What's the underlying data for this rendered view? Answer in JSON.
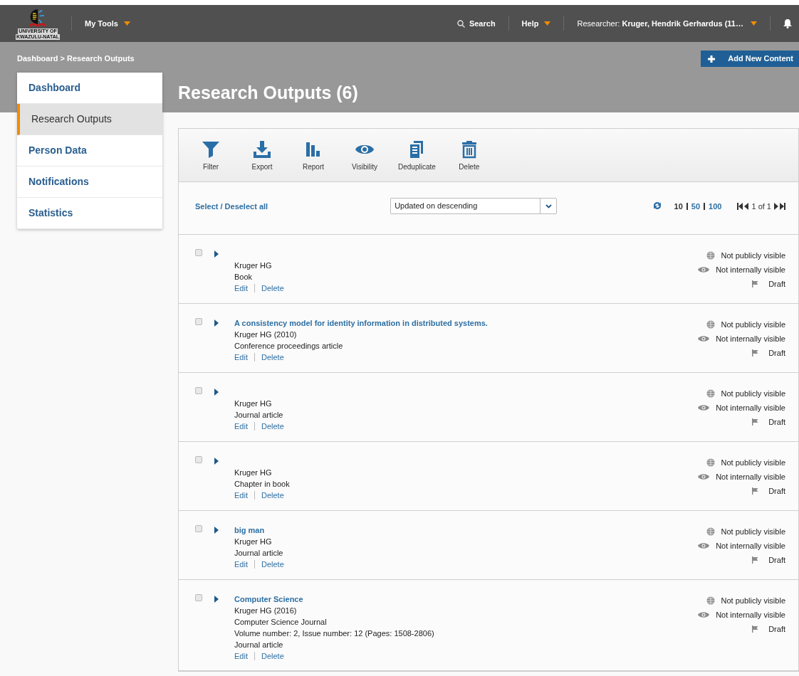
{
  "header": {
    "logo_lines": [
      "UNIVERSITY OF",
      "KWAZULU-NATAL"
    ],
    "menu": "My Tools",
    "search": "Search",
    "help": "Help",
    "user_label": "Researcher:",
    "user_name": "Kruger, Hendrik Gerhardus (11…"
  },
  "breadcrumb": "Dashboard > Research Outputs",
  "add_button": "Add New Content",
  "page_title": "Research Outputs (6)",
  "sidebar": [
    {
      "label": "Dashboard",
      "selected": false
    },
    {
      "label": "Research Outputs",
      "selected": true
    },
    {
      "label": "Person Data",
      "selected": false
    },
    {
      "label": "Notifications",
      "selected": false
    },
    {
      "label": "Statistics",
      "selected": false
    }
  ],
  "toolbar": [
    {
      "kind": "filter",
      "label": "Filter"
    },
    {
      "kind": "export",
      "label": "Export"
    },
    {
      "kind": "report",
      "label": "Report"
    },
    {
      "kind": "visibility",
      "label": "Visibility"
    },
    {
      "kind": "deduplicate",
      "label": "Deduplicate"
    },
    {
      "kind": "delete",
      "label": "Delete"
    }
  ],
  "select_all": "Select / Deselect all",
  "sort": {
    "value": "Updated on descending"
  },
  "page_sizes": [
    {
      "label": "10",
      "selected": true
    },
    {
      "label": "50",
      "selected": false
    },
    {
      "label": "100",
      "selected": false
    }
  ],
  "pager": "1 of 1",
  "outputs": [
    {
      "checked": false,
      "lines": [
        "Kruger HG",
        "Book"
      ],
      "edit": "Edit",
      "delete": "Delete",
      "public": "Not publicly visible",
      "internal": "Not internally visible",
      "status": "Draft"
    },
    {
      "checked": false,
      "title": "A consistency model for identity information in distributed systems.",
      "lines": [
        "Kruger HG (2010)",
        "Conference proceedings article"
      ],
      "edit": "Edit",
      "delete": "Delete",
      "public": "Not publicly visible",
      "internal": "Not internally visible",
      "status": "Draft"
    },
    {
      "checked": false,
      "lines": [
        "Kruger HG",
        "Journal article"
      ],
      "edit": "Edit",
      "delete": "Delete",
      "public": "Not publicly visible",
      "internal": "Not internally visible",
      "status": "Draft"
    },
    {
      "checked": false,
      "lines": [
        "Kruger HG",
        "Chapter in book"
      ],
      "edit": "Edit",
      "delete": "Delete",
      "public": "Not publicly visible",
      "internal": "Not internally visible",
      "status": "Draft"
    },
    {
      "checked": false,
      "title": "big man",
      "lines": [
        "Kruger HG",
        "Journal article"
      ],
      "edit": "Edit",
      "delete": "Delete",
      "public": "Not publicly visible",
      "internal": "Not internally visible",
      "status": "Draft"
    },
    {
      "checked": false,
      "title": "Computer Science",
      "lines": [
        "Kruger HG (2016)",
        "Computer Science Journal",
        "Volume number: 2, Issue number: 12 (Pages: 1508-2806)",
        "Journal article"
      ],
      "edit": "Edit",
      "delete": "Delete",
      "public": "Not publicly visible",
      "internal": "Not internally visible",
      "status": "Draft"
    }
  ]
}
